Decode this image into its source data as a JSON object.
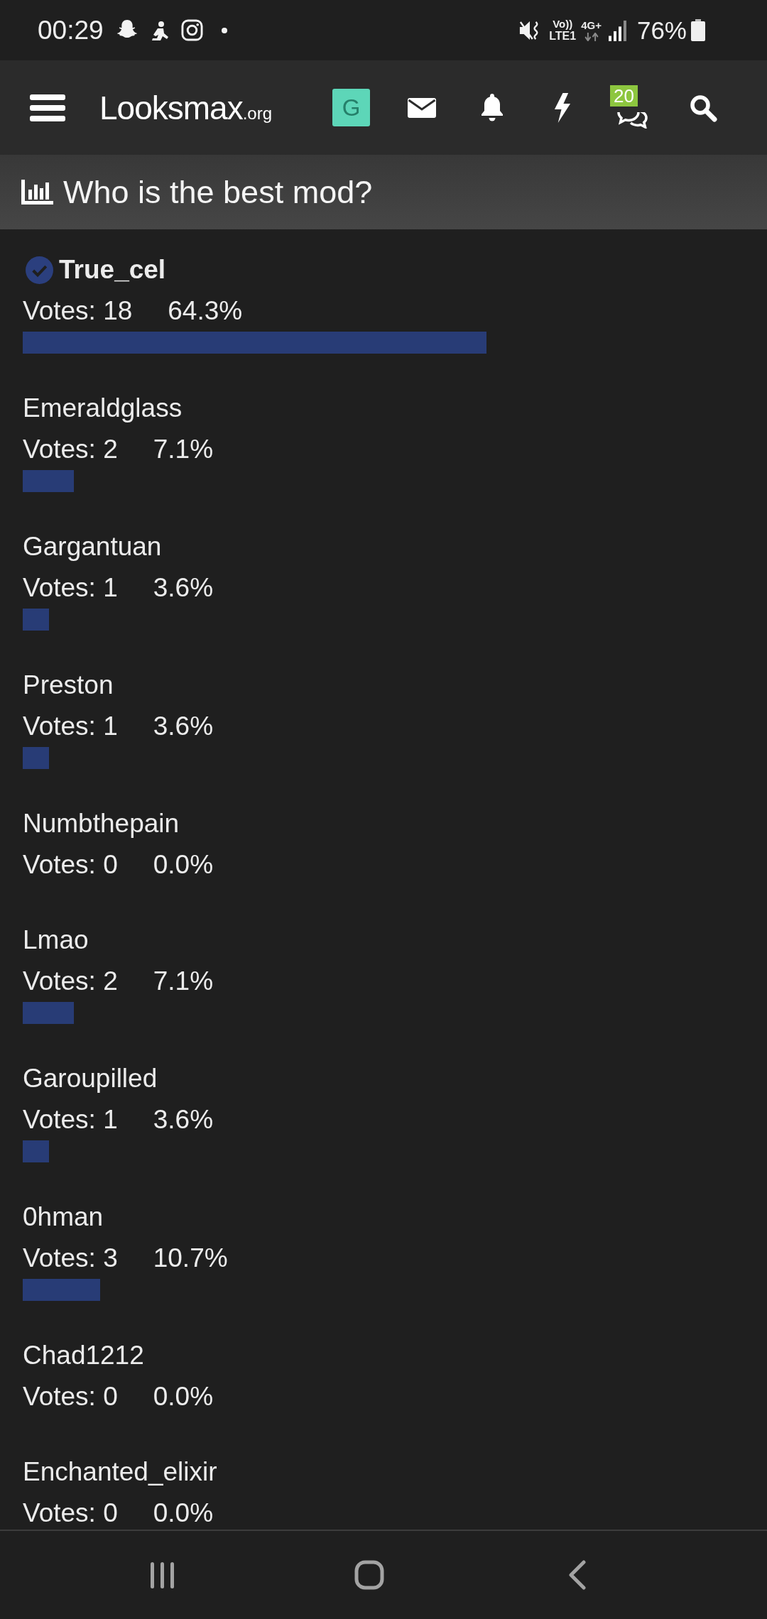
{
  "status_bar": {
    "time": "00:29",
    "volte": "Vo))",
    "lte": "LTE1",
    "network_type": "4G+",
    "battery": "76%"
  },
  "header": {
    "logo": {
      "name": "Looksmax",
      "suffix": ".org"
    },
    "avatar_letter": "G",
    "conversations_badge": "20"
  },
  "poll": {
    "title": "Who is the best mod?",
    "options": [
      {
        "name": "True_cel",
        "selected": true,
        "votes": "Votes: 18",
        "percent": "64.3%",
        "level": 0.643
      },
      {
        "name": "Emeraldglass",
        "selected": false,
        "votes": "Votes: 2",
        "percent": "7.1%",
        "level": 0.071
      },
      {
        "name": "Gargantuan",
        "selected": false,
        "votes": "Votes: 1",
        "percent": "3.6%",
        "level": 0.036
      },
      {
        "name": "Preston",
        "selected": false,
        "votes": "Votes: 1",
        "percent": "3.6%",
        "level": 0.036
      },
      {
        "name": "Numbthepain",
        "selected": false,
        "votes": "Votes: 0",
        "percent": "0.0%"
      },
      {
        "name": "Lmao",
        "selected": false,
        "votes": "Votes: 2",
        "percent": "7.1%",
        "level": 0.071
      },
      {
        "name": "Garoupilled",
        "selected": false,
        "votes": "Votes: 1",
        "percent": "3.6%",
        "level": 0.036
      },
      {
        "name": "0hman",
        "selected": false,
        "votes": "Votes: 3",
        "percent": "10.7%",
        "level": 0.107
      },
      {
        "name": "Chad1212",
        "selected": false,
        "votes": "Votes: 0",
        "percent": "0.0%"
      },
      {
        "name": "Enchanted_elixir",
        "selected": false,
        "votes": "Votes: 0",
        "percent": "0.0%"
      }
    ]
  }
}
